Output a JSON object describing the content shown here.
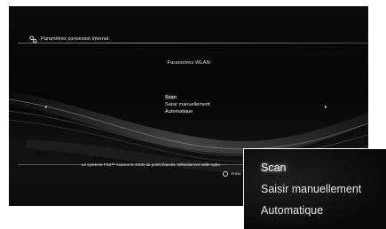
{
  "header": {
    "title": "Paramètres connexion Internet",
    "icon": "network-settings-icon"
  },
  "dialog": {
    "title": "Paramètres WLAN",
    "options": [
      "Scan",
      "Saisir manuellement",
      "Automatique"
    ],
    "selected": "Scan",
    "left_arrow": "◂",
    "right_arrow": "▸"
  },
  "help": {
    "text": "Le système PS3™ scanne le SSID du point d'accès. Sélectionner cette optio",
    "back_label": "Annu"
  },
  "zoom": {
    "options": [
      "Scan",
      "Saisir manuellement",
      "Automatique"
    ],
    "selected": "Scan"
  },
  "colors": {
    "background": "#050505",
    "text": "#e6e6e6",
    "highlight": "#ffffff"
  }
}
